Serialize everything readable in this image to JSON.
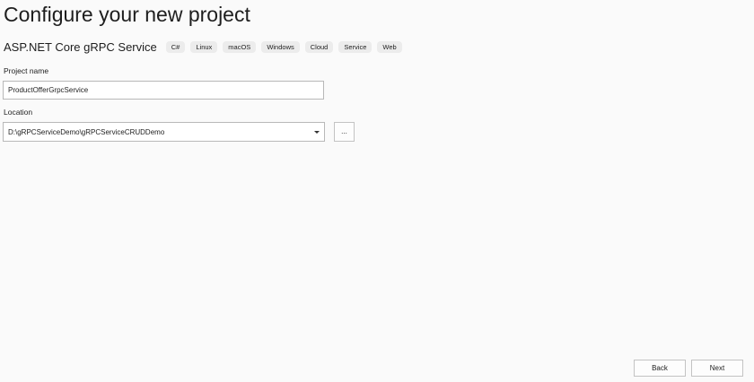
{
  "header": {
    "title": "Configure your new project"
  },
  "template": {
    "name": "ASP.NET Core gRPC Service",
    "tags": [
      "C#",
      "Linux",
      "macOS",
      "Windows",
      "Cloud",
      "Service",
      "Web"
    ]
  },
  "project_name": {
    "label": "Project name",
    "value": "ProductOfferGrpcService"
  },
  "location": {
    "label": "Location",
    "value": "D:\\gRPCServiceDemo\\gRPCServiceCRUDDemo",
    "browse_label": "..."
  },
  "footer": {
    "back_label": "Back",
    "next_label": "Next"
  }
}
